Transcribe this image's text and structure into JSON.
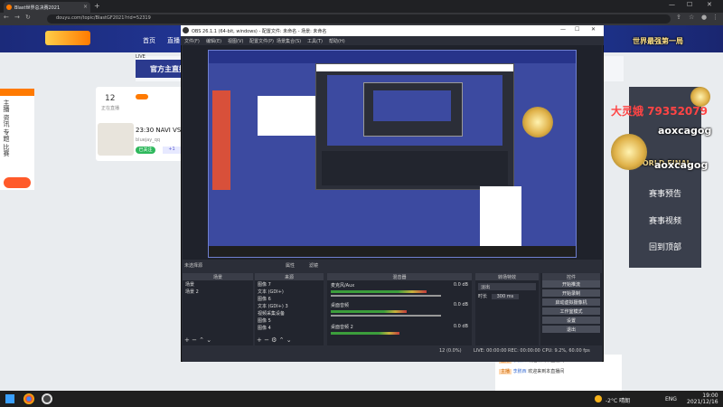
{
  "browser": {
    "tab_title": "Blast世界总决赛2021",
    "url": "douyu.com/topic/BlastGF2021?rid=52319",
    "new_tab": "+",
    "window_controls": [
      "—",
      "☐",
      "✕"
    ]
  },
  "douyu": {
    "nav": [
      "首页",
      "直播"
    ],
    "live_label": "LIVE",
    "official_button": "官方主直播",
    "feed": {
      "count": "12",
      "count_label": "正在直播",
      "item_time": "23:30 NAVI VS G",
      "item_meta": "bluejay_qq",
      "tag": "已关注",
      "like": "+1"
    },
    "left_sidebar": [
      "主播",
      "资讯",
      "专题",
      "比赛"
    ],
    "side_panel": {
      "top_label": "赛事预告",
      "links": [
        "赛事视频",
        "回到顶部"
      ]
    },
    "chat": [
      {
        "tag": "主播",
        "name": "李鹏西",
        "text": "欢迎来到本直播间"
      },
      {
        "tag": "主播",
        "name": "李鹏西",
        "text": "欢迎来到本直播间"
      }
    ]
  },
  "obs": {
    "title": "OBS 26.1.1 (64-bit, windows) - 配置文件: 未命名 - 场景: 未命名",
    "menu": [
      "文件(F)",
      "编辑(E)",
      "视图(V)",
      "配置文件(P)",
      "场景集合(S)",
      "工具(T)",
      "帮助(H)"
    ],
    "no_source_selected": "未选择源",
    "properties": "属性",
    "filters": "滤镜",
    "docks": {
      "scenes": {
        "title": "场景",
        "items": [
          "场景",
          "场景 2"
        ]
      },
      "sources": {
        "title": "来源",
        "items": [
          "图像 7",
          "文本 (GDI+)",
          "图像 6",
          "文本 (GDI+) 3",
          "视频采集设备",
          "图像 5",
          "图像 4",
          "显示器采集"
        ]
      },
      "mixer": {
        "title": "混音器",
        "channels": [
          {
            "name": "麦克风/Aux",
            "db": "0.0 dB",
            "level": 0.7
          },
          {
            "name": "桌面音频",
            "db": "0.0 dB",
            "level": 0.55
          },
          {
            "name": "桌面音频 2",
            "db": "0.0 dB",
            "level": 0.5
          }
        ]
      },
      "transitions": {
        "title": "转场特效",
        "type": "淡出",
        "duration_label": "时长",
        "duration": "300 ms"
      },
      "controls": {
        "title": "控件",
        "buttons": [
          "开始推流",
          "开始录制",
          "启动虚拟摄像机",
          "工作室模式",
          "设置",
          "退出"
        ]
      }
    },
    "status": {
      "live": "LIVE: 00:00:00",
      "rec": "REC: 00:00:00",
      "cpu": "CPU: 9.2%, 60.00 fps",
      "frames": "12 (0.0%)"
    }
  },
  "overlay": {
    "red_numbers": "大灵娥  79352079",
    "rose_text": [
      {
        "text": "aoxcagog",
        "x_hint": "right"
      },
      {
        "text": "aoxcagog",
        "x_hint": "right"
      }
    ],
    "brand": "WORLD FINAL",
    "world_final_right": "世界最强第一局"
  },
  "taskbar": {
    "weather": "-2°C  晴朗",
    "lang": "ENG",
    "time": "19:00",
    "date": "2021/12/16"
  },
  "colors": {
    "obs_bg": "#2b2e38",
    "douyu_blue": "#243a9e",
    "accent_orange": "#ff7a00",
    "overlay_red": "#ff4444"
  }
}
